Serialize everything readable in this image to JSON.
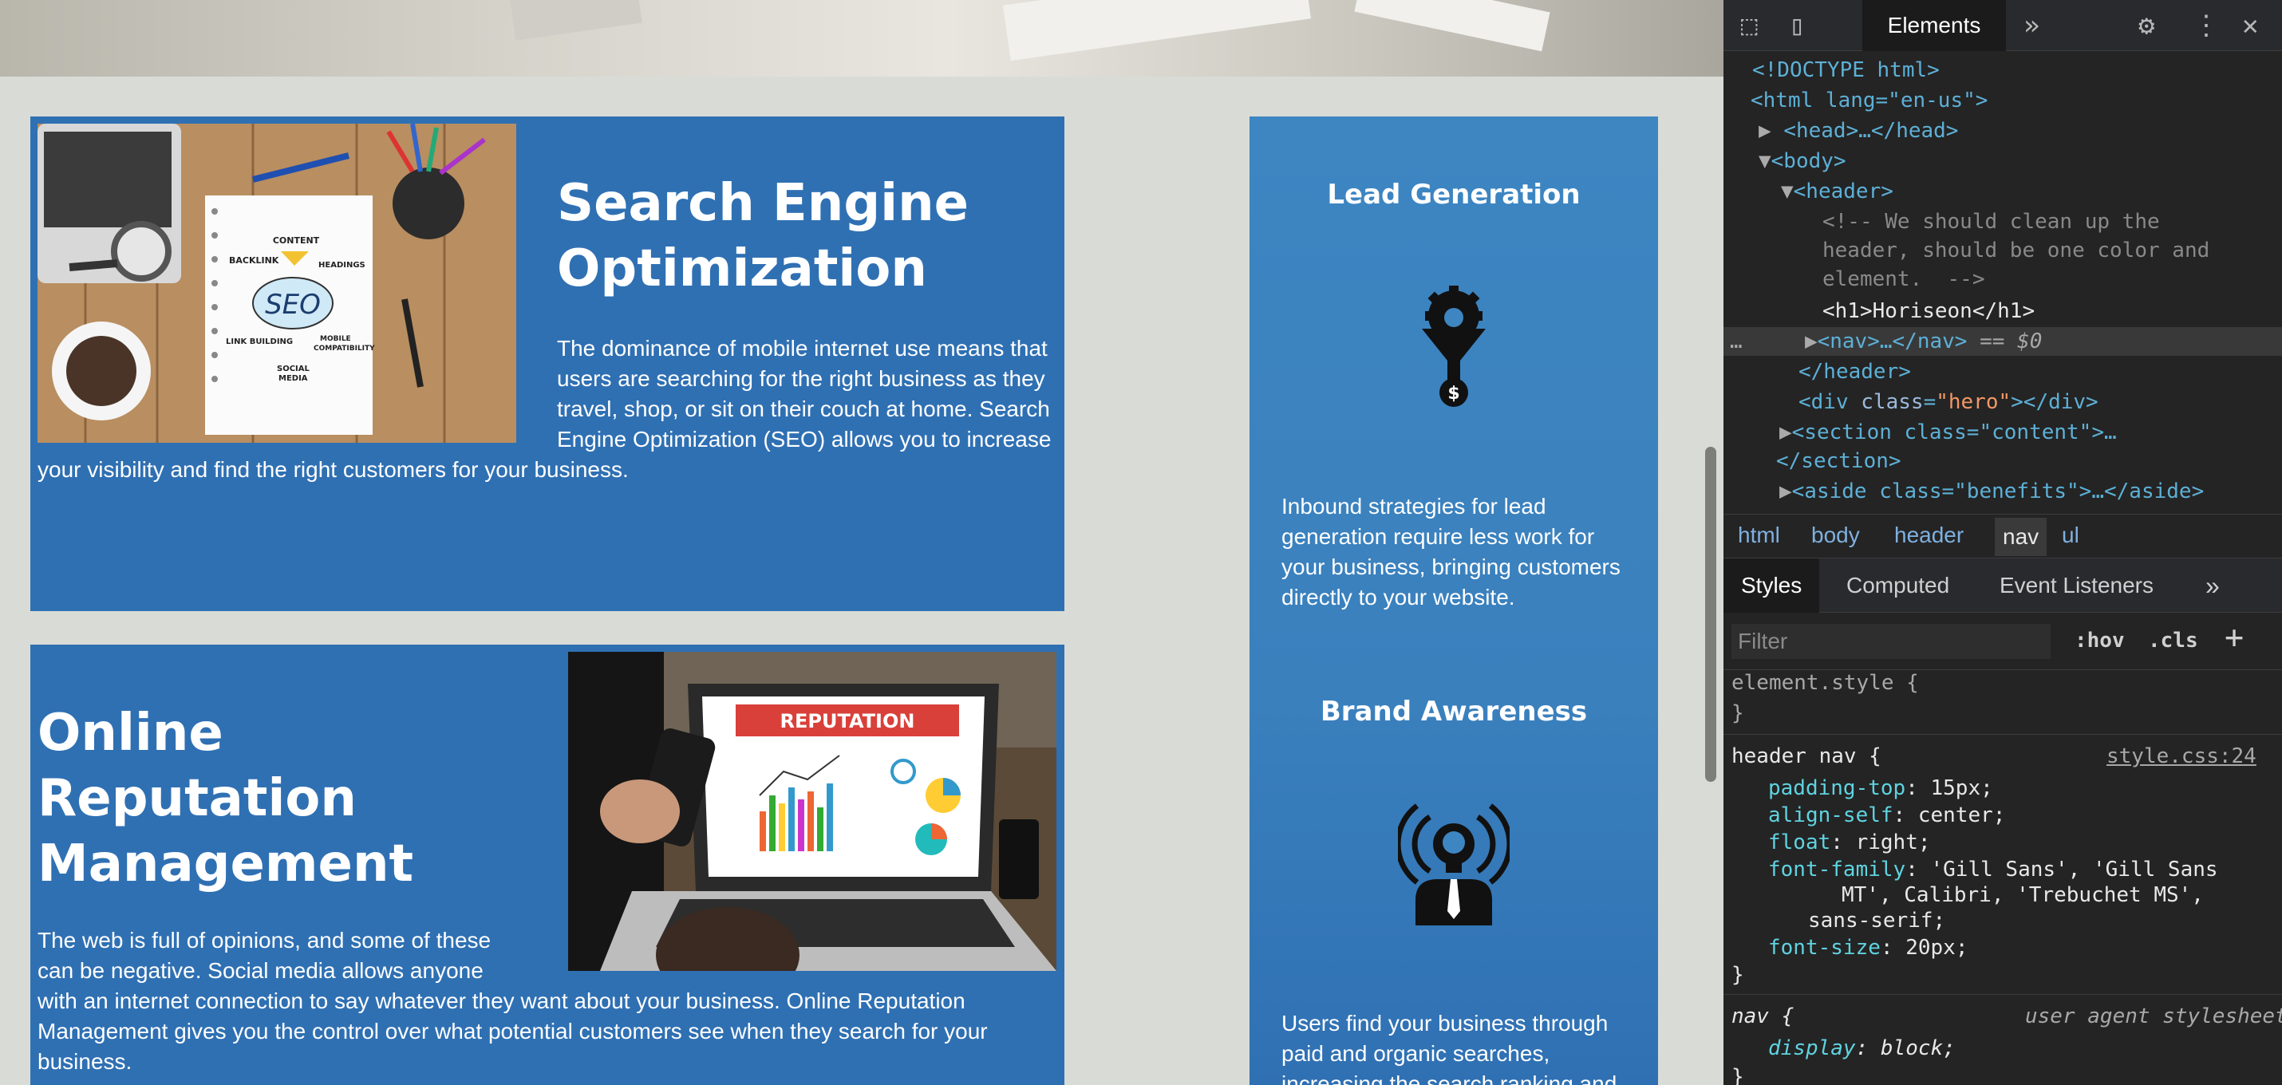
{
  "page": {
    "seo": {
      "title": "Search Engine Optimization",
      "body": "The dominance of mobile internet use means that users are searching for the right business as they travel, shop, or sit on their couch at home. Search Engine Optimization (SEO) allows you to increase your visibility and find the right customers for your business.",
      "image_words": [
        "CONTENT",
        "BACKLINK",
        "HEADINGS",
        "SEO",
        "LINK BUILDING",
        "MOBILE COMPATIBILITY",
        "SOCIAL MEDIA"
      ]
    },
    "orm": {
      "title": "Online Reputation Management",
      "body": "The web is full of opinions, and some of these can be negative. Social media allows anyone with an internet connection to say whatever they want about your business. Online Reputation Management gives you the control over what potential customers see when they search for your business.",
      "image_word": "REPUTATION"
    },
    "benefits": {
      "lead_title": "Lead Generation",
      "lead_body": "Inbound strategies for lead generation require less work for your business, bringing customers directly to your website.",
      "brand_title": "Brand Awareness",
      "brand_body": "Users find your business through paid and organic searches, increasing the search ranking and"
    }
  },
  "devtools": {
    "tabs": {
      "active": "Elements"
    },
    "dom_lines": {
      "doctype": "<!DOCTYPE html>",
      "html_open": "<html lang=\"en-us\">",
      "head": "<head>…</head>",
      "body": "<body>",
      "header": "<header>",
      "comment1": "<!-- We should clean up the",
      "comment2": "header, should be one color and",
      "comment3": "element.  -->",
      "h1": "<h1>Horiseon</h1>",
      "nav": "<nav>…</nav>",
      "nav_suffix": "== $0",
      "header_close": "</header>",
      "hero": "<div class=\"hero\"></div>",
      "section": "<section class=\"content\">…",
      "section_close": "</section>",
      "aside": "<aside class=\"benefits\">…</aside>"
    },
    "breadcrumbs": [
      "html",
      "body",
      "header",
      "nav",
      "ul"
    ],
    "breadcrumb_active": "nav",
    "style_tabs": [
      "Styles",
      "Computed",
      "Event Listeners"
    ],
    "filter_placeholder": "Filter",
    "filter_hov": ":hov",
    "filter_cls": ".cls",
    "rules": {
      "element_style": "element.style {",
      "brace_close": "}",
      "header_nav_selector": "header nav {",
      "header_nav_source": "style.css:24",
      "props": [
        {
          "name": "padding-top",
          "value": "15px;"
        },
        {
          "name": "align-self",
          "value": "center;"
        },
        {
          "name": "float",
          "value": "right;"
        },
        {
          "name": "font-family",
          "value": "'Gill Sans', 'Gill Sans"
        },
        {
          "name": "",
          "value": "MT', Calibri, 'Trebuchet MS',"
        },
        {
          "name": "",
          "value": "sans-serif;"
        },
        {
          "name": "font-size",
          "value": "20px;"
        }
      ],
      "nav_selector": "nav {",
      "nav_source": "user agent stylesheet",
      "nav_prop": {
        "name": "display",
        "value": "block;"
      }
    },
    "colors": {
      "panel": "#242424",
      "tag": "#5db0d7",
      "attr_value": "#f29766",
      "css_prop": "#5fd3e0"
    }
  },
  "colors": {
    "card": "#2f70b3",
    "background": "#d9dcd6",
    "aside": "#3d86c2"
  }
}
